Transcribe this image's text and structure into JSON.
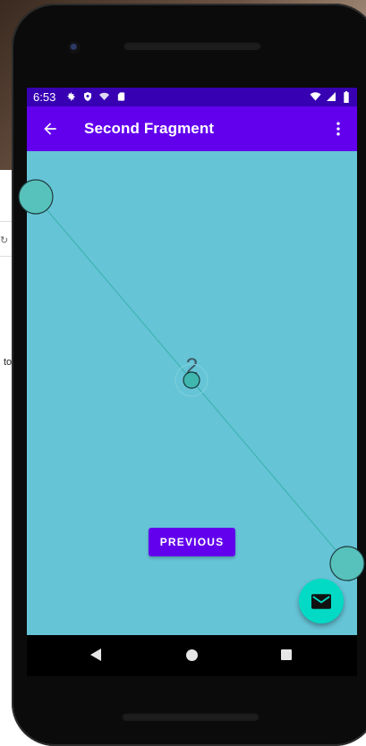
{
  "status_bar": {
    "time": "6:53",
    "icons_left": [
      "settings-icon",
      "shield-icon",
      "wifi-question-icon",
      "sd-card-icon"
    ],
    "icons_right": [
      "wifi-icon",
      "cell-signal-icon",
      "battery-icon"
    ]
  },
  "app_bar": {
    "title": "Second Fragment",
    "back_icon": "arrow-back-icon",
    "overflow_icon": "more-vert-icon"
  },
  "content": {
    "number": "2",
    "previous_label": "PREVIOUS"
  },
  "fab": {
    "icon": "mail-icon"
  },
  "nav_bar": {
    "buttons": [
      "back",
      "home",
      "recents"
    ]
  },
  "background": {
    "side_text": "to",
    "reload_glyph": "↻"
  },
  "colors": {
    "status_bar": "#3700b3",
    "app_bar": "#6200ee",
    "content_bg": "#66c4d7",
    "fab": "#03dac5",
    "button": "#6200ee"
  }
}
